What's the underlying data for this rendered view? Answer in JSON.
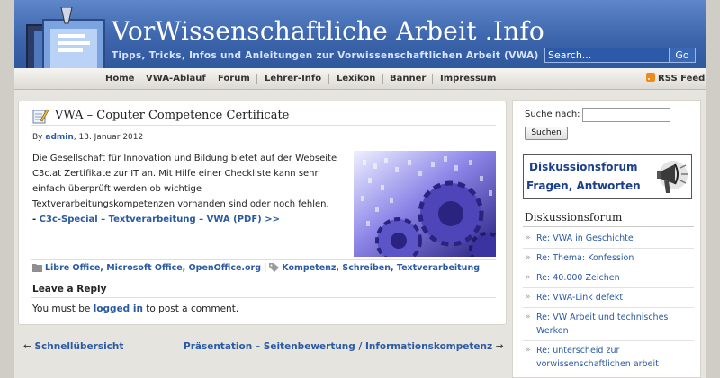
{
  "header": {
    "title": "VorWissenschaftliche Arbeit .Info",
    "tagline": "Tipps, Tricks, Infos und Anleitungen zur Vorwissenschaftlichen Arbeit (VWA)",
    "search_placeholder": "Search...",
    "go_label": "Go"
  },
  "nav": {
    "items": [
      "Home",
      "VWA-Ablauf",
      "Forum",
      "Lehrer-Info",
      "Lexikon",
      "Banner",
      "Impressum"
    ],
    "rss_label": "RSS Feed"
  },
  "post": {
    "title": "VWA – Coputer Competence Certificate",
    "by": "By",
    "author": "admin",
    "date": ", 13. Januar 2012",
    "body": "Die Gesellschaft für Innovation und Bildung bietet auf der Webseite C3c.at Zertifikate zur IT an. Mit Hilfe einer Checkliste kann sehr einfach überprüft werden ob wichtige Textverarbeitungskompetenzen vorhanden sind oder noch fehlen.",
    "link_prefix": "- ",
    "link_text": "C3c-Special – Textverarbeitung – VWA (PDF) >>",
    "categories": "Libre Office, Microsoft Office, OpenOffice.org",
    "separator": " | ",
    "tags": "Kompetenz, Schreiben, Textverarbeitung",
    "reply_heading": "Leave a Reply",
    "reply_pre": "You must be ",
    "reply_link": "logged in",
    "reply_post": " to post a comment."
  },
  "postnav": {
    "prev_arrow": "←",
    "prev": "Schnellübersicht",
    "next": "Präsentation – Seitenbewertung / Informationskompetenz",
    "next_arrow": "→"
  },
  "sidebar": {
    "search_label": "Suche nach:",
    "search_button": "Suchen",
    "banner_line1": "Diskussionsforum",
    "banner_line2": "Fragen, Antworten",
    "widget_title": "Diskussionsforum",
    "recent": [
      "Re: VWA in Geschichte",
      "Re: Thema: Konfession",
      "Re: 40.000 Zeichen",
      "Re: VWA-Link defekt",
      "Re: VW Arbeit und technisches Werken",
      "Re: unterscheid zur vorwissenschaftlichen arbeit"
    ]
  },
  "colors": {
    "header_blue": "#3d66ad",
    "link_blue": "#2a5aa4",
    "background": "#e6e4de"
  }
}
